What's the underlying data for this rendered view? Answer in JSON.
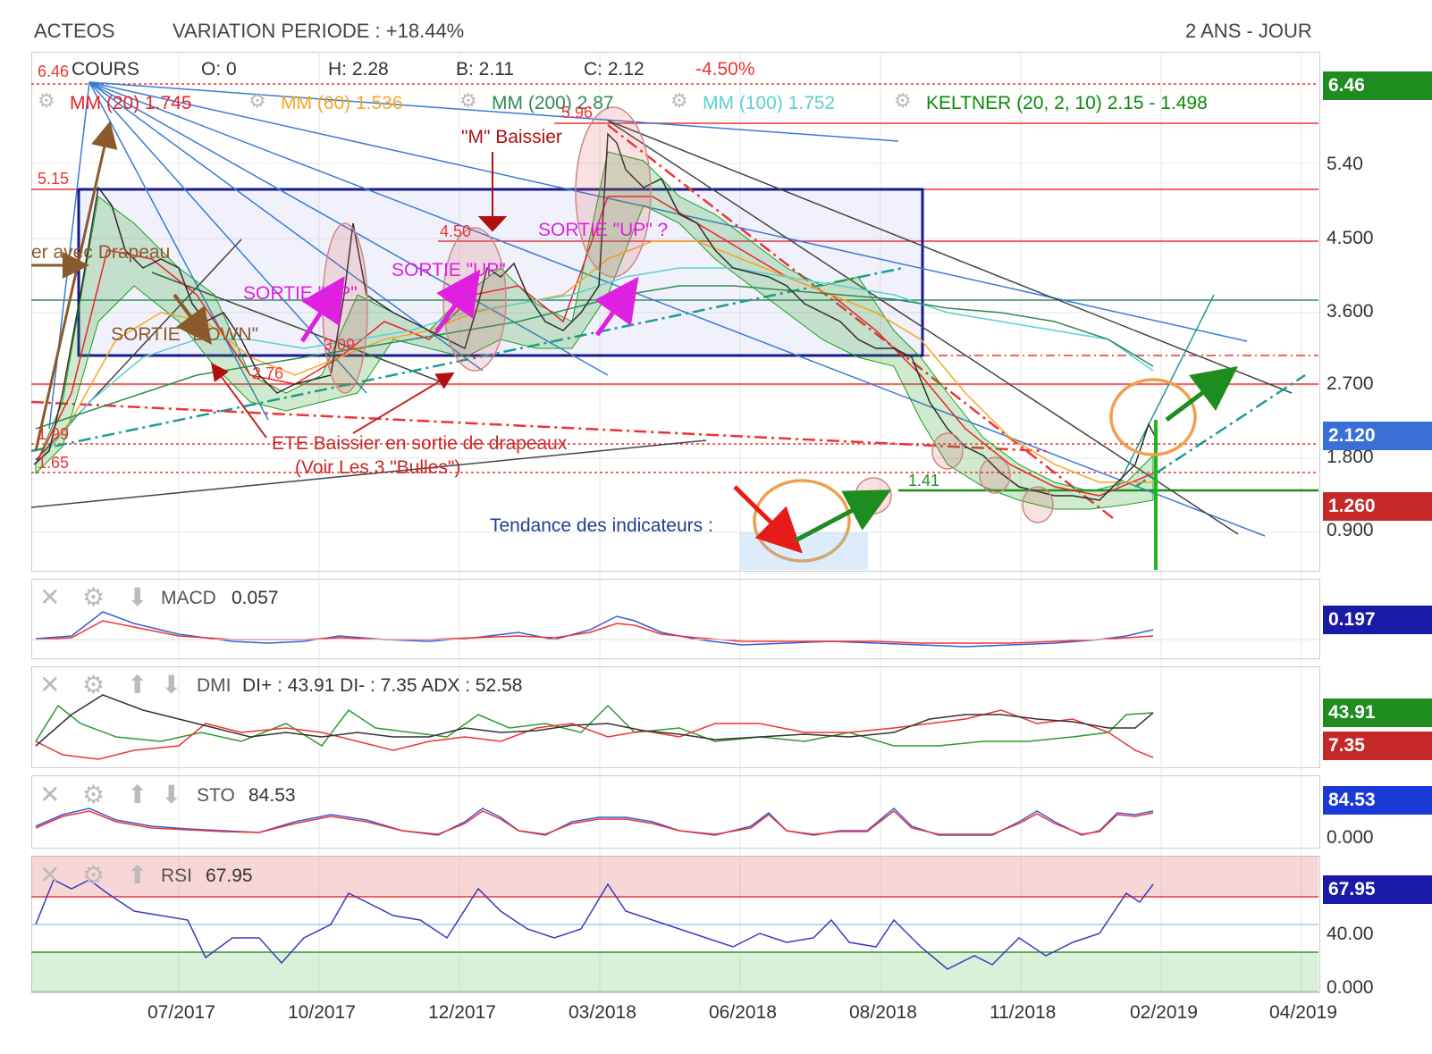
{
  "header": {
    "ticker": "ACTEOS",
    "variation": "VARIATION PERIODE : +18.44%",
    "period": "2 ANS - JOUR"
  },
  "legend": {
    "cours_label": "COURS",
    "open": "O: 0",
    "high": "H: 2.28",
    "low": "B: 2.11",
    "close": "C: 2.12",
    "change": "-4.50%",
    "mm20": "MM (20) 1.745",
    "mm60": "MM (60) 1.536",
    "mm200": "MM (200) 2.87",
    "mm100": "MM (100) 1.752",
    "keltner": "KELTNER (20, 2, 10) 2.15 - 1.498"
  },
  "colors": {
    "mm20": "#e8232a",
    "mm60": "#f5a623",
    "mm200": "#2e8b57",
    "mm100": "#5bd0d0",
    "keltner": "#18a018",
    "trend_blue": "#3a7bd5",
    "box": "#1a1a8c",
    "annot_red": "#c62828",
    "annot_magenta": "#e020e0",
    "annot_brown": "#8b5a2b"
  },
  "annotations": {
    "m_baissier": "\"M\" Baissier",
    "sortie_up_1": "SORTIE \"UP\"",
    "sortie_up_2": "SORTIE \"UP\"",
    "sortie_up_3": "SORTIE \"UP\" ?",
    "sortie_down": "SORTIE \"DOWN\"",
    "drapeau": "er avec Drapeau",
    "ete_1": "ETE Baissier en sortie de drapeaux",
    "ete_2": "(Voir Les 3 \"Bulles\")",
    "tendance": "Tendance des indicateurs :",
    "lvl_646": "6.46",
    "lvl_596": "5.96",
    "lvl_515": "5.15",
    "lvl_450": "4.50",
    "lvl_309": "3.09",
    "lvl_276": "2.76",
    "lvl_199": "1.99",
    "lvl_165": "1.65",
    "lvl_141": "1.41"
  },
  "price_axis": {
    "ticks": [
      "5.40",
      "4.500",
      "3.600",
      "2.700",
      "1.800",
      "0.900"
    ],
    "badges": [
      {
        "value": "6.46",
        "color": "#1e8c1e"
      },
      {
        "value": "2.120",
        "color": "#3a6fd8"
      },
      {
        "value": "1.260",
        "color": "#c62828"
      }
    ]
  },
  "chart_data": [
    {
      "type": "line",
      "name": "price",
      "x": [
        "2017-03",
        "2017-04",
        "2017-05",
        "2017-06",
        "2017-07",
        "2017-08",
        "2017-09",
        "2017-10",
        "2017-11",
        "2017-12",
        "2018-01",
        "2018-02",
        "2018-03",
        "2018-04",
        "2018-05",
        "2018-06",
        "2018-07",
        "2018-08",
        "2018-09",
        "2018-10",
        "2018-11",
        "2018-12",
        "2019-01",
        "2019-02"
      ],
      "series": [
        {
          "name": "COURS",
          "values": [
            1.7,
            5.0,
            4.0,
            3.7,
            2.7,
            2.8,
            2.6,
            3.5,
            3.4,
            3.0,
            4.0,
            3.2,
            5.9,
            4.9,
            4.4,
            3.9,
            3.4,
            3.1,
            2.0,
            1.6,
            1.5,
            1.4,
            1.2,
            2.12
          ]
        }
      ],
      "ylim": [
        0.6,
        6.7
      ],
      "levels": [
        6.46,
        5.96,
        5.15,
        4.5,
        3.09,
        2.76,
        1.99,
        1.65,
        1.41
      ]
    },
    {
      "type": "line",
      "title": "MACD",
      "x": [
        "2017-03",
        "2017-05",
        "2017-07",
        "2017-09",
        "2017-11",
        "2018-01",
        "2018-03",
        "2018-05",
        "2018-07",
        "2018-09",
        "2018-11",
        "2019-01",
        "2019-02"
      ],
      "series": [
        {
          "name": "MACD",
          "values": [
            0.0,
            0.5,
            0.1,
            -0.05,
            0.05,
            0.0,
            0.4,
            0.05,
            0.0,
            -0.1,
            -0.05,
            0.0,
            0.057
          ]
        }
      ],
      "value_label": "0.057",
      "badge": "0.197"
    },
    {
      "type": "line",
      "title": "DMI",
      "x": [
        "2017-03",
        "2017-05",
        "2017-07",
        "2017-09",
        "2017-11",
        "2018-01",
        "2018-03",
        "2018-05",
        "2018-07",
        "2018-09",
        "2018-11",
        "2019-01",
        "2019-02"
      ],
      "series": [
        {
          "name": "DI+",
          "values": [
            25,
            45,
            20,
            25,
            40,
            30,
            45,
            30,
            30,
            25,
            20,
            22,
            43.91
          ]
        },
        {
          "name": "DI-",
          "values": [
            20,
            5,
            25,
            20,
            15,
            25,
            20,
            25,
            35,
            35,
            40,
            35,
            7.35
          ]
        },
        {
          "name": "ADX",
          "values": [
            20,
            55,
            35,
            25,
            20,
            25,
            30,
            25,
            25,
            35,
            40,
            30,
            52.58
          ]
        }
      ],
      "value_label": "DI+ : 43.91 DI- : 7.35 ADX : 52.58",
      "badges": [
        "43.91",
        "7.35"
      ]
    },
    {
      "type": "line",
      "title": "STO",
      "x": [
        "2017-03",
        "2017-05",
        "2017-07",
        "2017-09",
        "2017-11",
        "2018-01",
        "2018-03",
        "2018-05",
        "2018-07",
        "2018-09",
        "2018-11",
        "2019-01",
        "2019-02"
      ],
      "series": [
        {
          "name": "STO",
          "values": [
            40,
            90,
            30,
            20,
            85,
            30,
            90,
            20,
            80,
            20,
            70,
            30,
            84.53
          ]
        }
      ],
      "value_label": "84.53",
      "ticks": [
        "0.000"
      ],
      "badge": "84.53"
    },
    {
      "type": "line",
      "title": "RSI",
      "x": [
        "2017-03",
        "2017-05",
        "2017-07",
        "2017-09",
        "2017-11",
        "2018-01",
        "2018-03",
        "2018-05",
        "2018-07",
        "2018-09",
        "2018-11",
        "2019-01",
        "2019-02"
      ],
      "series": [
        {
          "name": "RSI",
          "values": [
            55,
            75,
            45,
            30,
            70,
            40,
            75,
            35,
            45,
            30,
            25,
            40,
            67.95
          ]
        }
      ],
      "value_label": "67.95",
      "ticks": [
        "40.00",
        "0.000"
      ],
      "badge": "67.95"
    }
  ],
  "x_axis": [
    "07/2017",
    "10/2017",
    "12/2017",
    "03/2018",
    "06/2018",
    "08/2018",
    "11/2018",
    "02/2019",
    "04/2019"
  ]
}
